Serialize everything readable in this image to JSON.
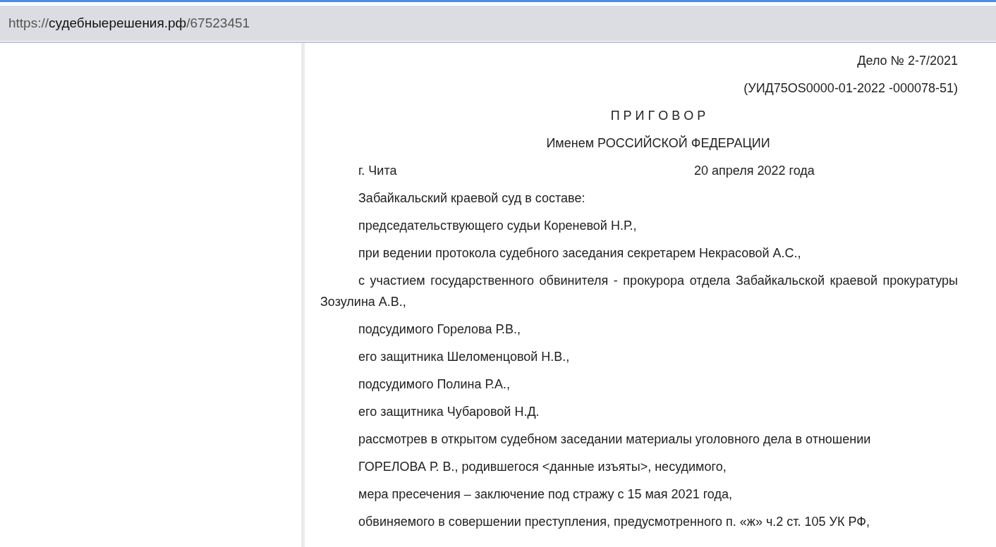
{
  "address_bar": {
    "scheme": "https://",
    "host": "судебныерешения.рф",
    "path": "/67523451"
  },
  "document": {
    "paragraphs": [
      {
        "kind": "right",
        "text": "Дело № 2-7/2021"
      },
      {
        "kind": "right",
        "text": "(УИД75OS0000-01-2022 -000078-51)"
      },
      {
        "kind": "center",
        "text": "П Р И Г О В О Р"
      },
      {
        "kind": "center",
        "text": "Именем РОССИЙСКОЙ ФЕДЕРАЦИИ"
      },
      {
        "kind": "place-date",
        "place": "г. Чита",
        "date": "20 апреля 2022 года"
      },
      {
        "kind": "body",
        "text": "Забайкальский краевой суд в составе:"
      },
      {
        "kind": "body",
        "text": "председательствующего судьи Кореневой Н.Р.,"
      },
      {
        "kind": "body",
        "text": "при ведении протокола судебного заседания секретарем Некрасовой А.С.,"
      },
      {
        "kind": "body",
        "text": "с участием государственного обвинителя - прокурора отдела Забайкальской краевой прокуратуры Зозулина А.В.,"
      },
      {
        "kind": "body",
        "text": "подсудимого Горелова Р.В.,"
      },
      {
        "kind": "body",
        "text": "его защитника Шеломенцовой Н.В.,"
      },
      {
        "kind": "body",
        "text": "подсудимого Полина Р.А.,"
      },
      {
        "kind": "body",
        "text": "его защитника Чубаровой Н.Д."
      },
      {
        "kind": "body",
        "text": "рассмотрев в открытом судебном заседании материалы уголовного дела в отношении"
      },
      {
        "kind": "body",
        "text": "ГОРЕЛОВА Р. В., родившегося <данные изъяты>, несудимого,"
      },
      {
        "kind": "body",
        "text": "мера пресечения – заключение под стражу с 15 мая 2021 года,"
      },
      {
        "kind": "body",
        "text": "обвиняемого в совершении преступления, предусмотренного п. «ж» ч.2 ст. 105 УК РФ,"
      }
    ]
  }
}
